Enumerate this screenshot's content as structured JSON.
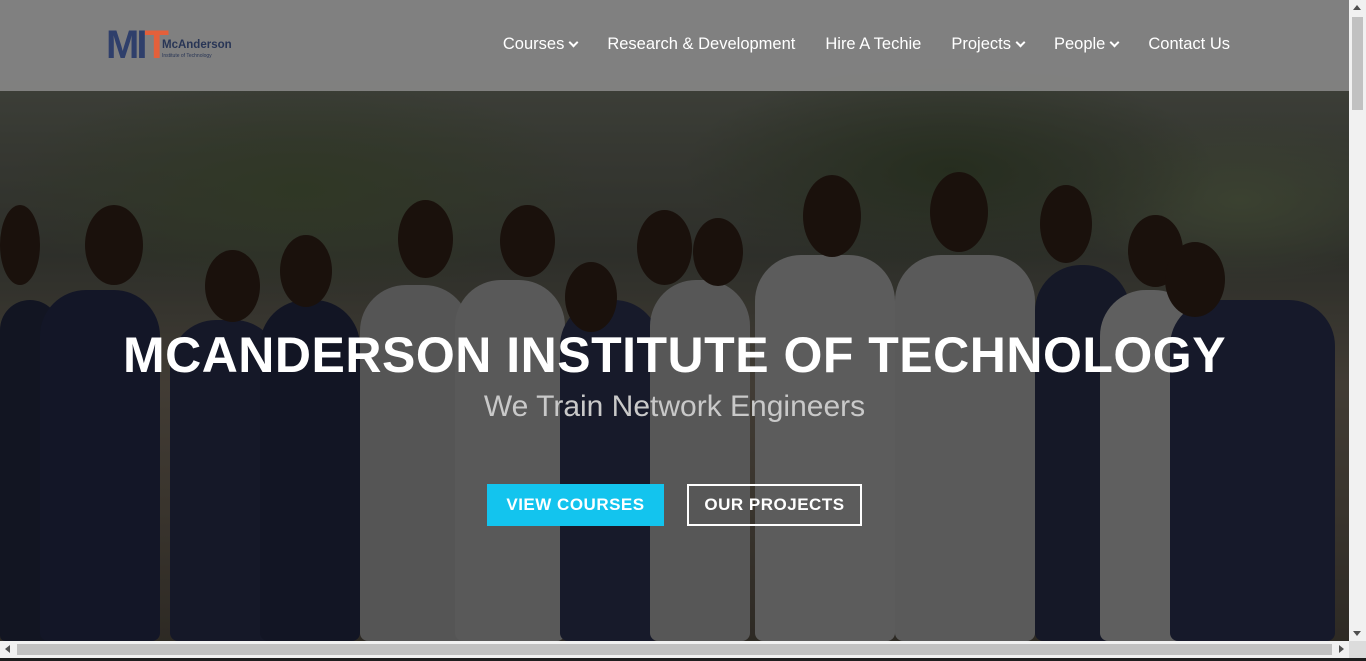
{
  "brand": {
    "name": "McAnderson",
    "tagline": "Institute of Technology",
    "mark": [
      "M",
      "I",
      "T"
    ],
    "colors": {
      "navy": "#2f3f6b",
      "orange": "#e4603b"
    }
  },
  "nav": {
    "items": [
      {
        "label": "Courses",
        "dropdown": true
      },
      {
        "label": "Research & Development",
        "dropdown": false
      },
      {
        "label": "Hire A Techie",
        "dropdown": false
      },
      {
        "label": "Projects",
        "dropdown": true
      },
      {
        "label": "People",
        "dropdown": true
      },
      {
        "label": "Contact Us",
        "dropdown": false
      }
    ]
  },
  "hero": {
    "title": "MCANDERSON INSTITUTE OF TECHNOLOGY",
    "subtitle": "We Train Network Engineers",
    "primary_button": "VIEW COURSES",
    "secondary_button": "OUR PROJECTS",
    "accent_color": "#13c4ee"
  }
}
